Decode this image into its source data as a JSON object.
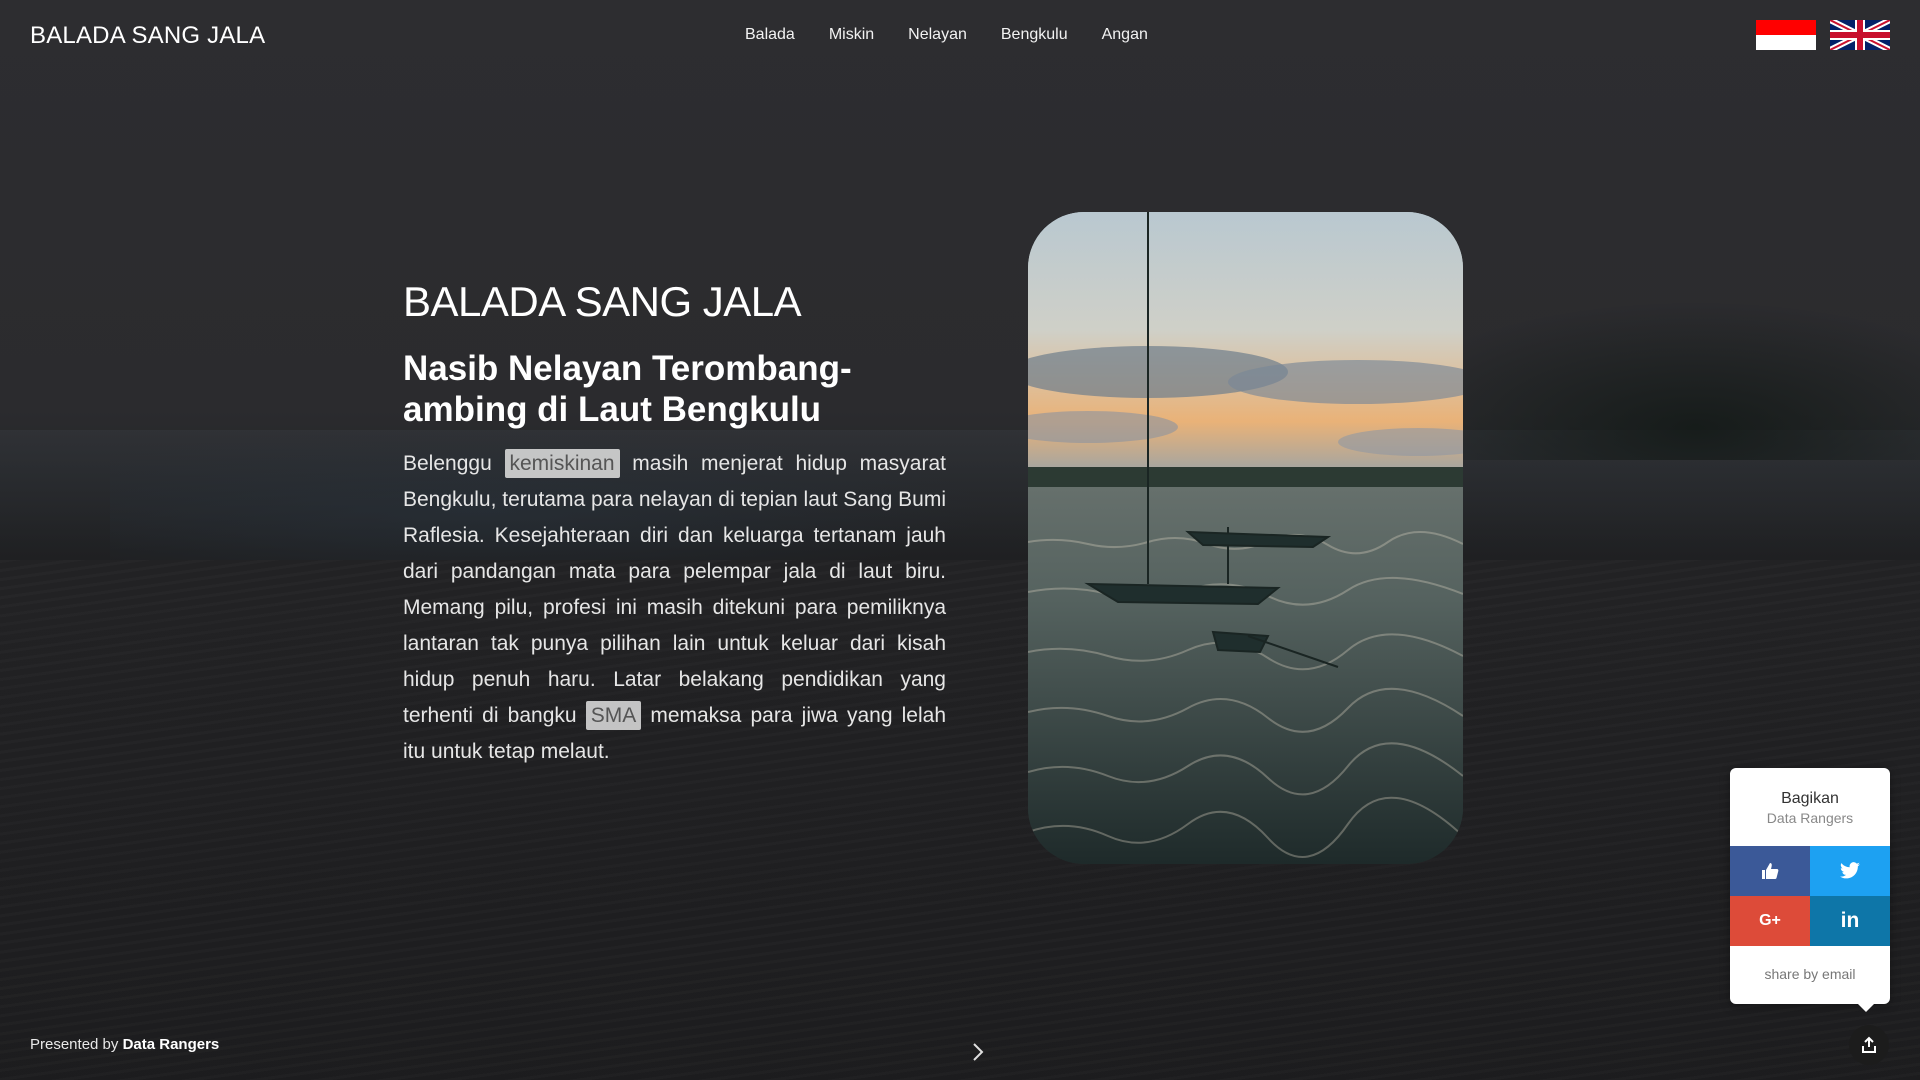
{
  "header": {
    "site_title": "BALADA SANG JALA",
    "nav": [
      "Balada",
      "Miskin",
      "Nelayan",
      "Bengkulu",
      "Angan"
    ]
  },
  "languages": [
    {
      "name": "indonesian-flag-icon",
      "colors": [
        "#ff0000",
        "#ffffff"
      ]
    },
    {
      "name": "uk-flag-icon",
      "colors": [
        "#012169",
        "#ffffff",
        "#c8102e"
      ]
    }
  ],
  "hero": {
    "title": "BALADA SANG JALA",
    "subtitle": "Nasib Nelayan Terombang-ambing di Laut Bengkulu",
    "text_before_1": "Belenggu ",
    "highlight_1": "kemiskinan",
    "text_between": " masih menjerat hidup masyarat Bengkulu, terutama para nelayan di tepian laut Sang Bumi Raflesia. Kesejahteraan diri dan keluarga tertanam jauh dari pandangan mata para pelempar jala di laut biru. Memang pilu, profesi ini masih ditekuni para pemiliknya lantaran tak punya pilihan lain untuk keluar dari kisah hidup penuh haru. Latar belakang pendidikan yang terhenti di bangku ",
    "highlight_2": "SMA",
    "text_after_2": " memaksa para jiwa yang lelah itu untuk tetap melaut."
  },
  "footer": {
    "presented_prefix": "Presented by ",
    "presented_by": "Data Rangers"
  },
  "share": {
    "title": "Bagikan",
    "subtitle": "Data Rangers",
    "buttons": [
      "thumbs-up-icon",
      "twitter-icon",
      "google-plus-icon",
      "linkedin-icon"
    ],
    "google_plus_label": "G+",
    "linkedin_label": "in",
    "email_label": "share by email"
  },
  "colors": {
    "facebook": "#3b5998",
    "twitter": "#1da1f2",
    "google_plus": "#dd4b39",
    "linkedin": "#0e76a8",
    "highlight_bg": "#e1e1e1"
  }
}
